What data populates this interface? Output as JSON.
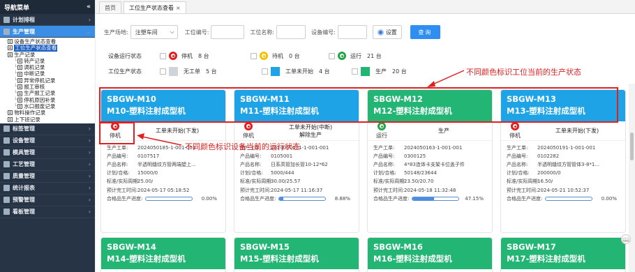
{
  "sidebar": {
    "title": "导航菜单",
    "collapse_icon": "«",
    "sections_top": [
      {
        "label": "计划排程",
        "icon": "calendar-icon"
      },
      {
        "label": "生产管理",
        "icon": "gear-icon",
        "active": true
      }
    ],
    "tree": [
      {
        "label": "设备生产状态查看",
        "level": 1
      },
      {
        "label": "工位生产状态查看",
        "level": 1,
        "selected": true
      },
      {
        "label": "生产记录",
        "level": 1,
        "folder": true
      },
      {
        "label": "转产记录",
        "level": 2
      },
      {
        "label": "调机记录",
        "level": 2
      },
      {
        "label": "中断记录",
        "level": 2
      },
      {
        "label": "异常停机记录",
        "level": 2
      },
      {
        "label": "报工审核",
        "level": 2
      },
      {
        "label": "生产报工记录",
        "level": 2
      },
      {
        "label": "停机原因补录",
        "level": 2
      },
      {
        "label": "水口报废记录",
        "level": 2
      },
      {
        "label": "物料操作记录",
        "level": 1
      },
      {
        "label": "上下班记录",
        "level": 1
      }
    ],
    "sections_bottom": [
      {
        "label": "标签管理",
        "icon": "tag-icon"
      },
      {
        "label": "设备管理",
        "icon": "device-icon"
      },
      {
        "label": "模具管理",
        "icon": "mold-icon"
      },
      {
        "label": "工艺管理",
        "icon": "process-icon"
      },
      {
        "label": "质量管理",
        "icon": "quality-icon"
      },
      {
        "label": "统计报表",
        "icon": "chart-icon"
      },
      {
        "label": "预警管理",
        "icon": "alert-icon"
      },
      {
        "label": "看板管理",
        "icon": "board-icon"
      }
    ]
  },
  "tabs": [
    {
      "label": "首页"
    },
    {
      "label": "工位生产状态查看",
      "close": "×",
      "active": true
    }
  ],
  "filter": {
    "site_label": "生产场地:",
    "site_value": "注塑车间",
    "station_no_label": "工位编号:",
    "station_name_label": "工位名称:",
    "device_no_label": "设备编号:",
    "settings_label": "设置",
    "query_label": "查询"
  },
  "legend": {
    "run_label": "设备运行状态",
    "prod_label": "工位生产状态",
    "run_items": [
      {
        "label": "停机",
        "count": "8 台",
        "color": "#e02020"
      },
      {
        "label": "待机",
        "count": "0 台",
        "color": "#f2c200"
      },
      {
        "label": "运行",
        "count": "21 台",
        "color": "#21a648"
      }
    ],
    "prod_items": [
      {
        "label": "无工单",
        "count": "5 台",
        "color": "#cfd4da"
      },
      {
        "label": "工单未开始",
        "count": "4 台",
        "color": "#1ea3e6"
      },
      {
        "label": "生产",
        "count": "20 台",
        "color": "#22b573"
      }
    ]
  },
  "annotations": {
    "station_status_note": "不同颜色标识工位当前的生产状态",
    "device_status_note": "不同颜色标识设备当前的运行状态"
  },
  "field_labels": {
    "order": "生产工单:",
    "product_no": "产品编号:",
    "product_name": "产品名称:",
    "plan": "计划/合格:",
    "cycle": "标准/实际周期:",
    "finish": "预计完工时间:",
    "progress": "合格品生产进度:"
  },
  "cards": [
    {
      "code": "SBGW-M10",
      "name": "M10-塑料注射成型机",
      "head_color": "#1ea3e6",
      "run_label": "停机",
      "run_color": "#e02020",
      "work_status": "工单未开始(下发)",
      "work_sub": "",
      "order": "2024050185-1-001-001",
      "product_no": "0107517",
      "product_name": "半透明缝纹方管两端塑上...",
      "plan": "15000/0",
      "cycle": "25.00/",
      "finish": "2024-05-17 05:18:52",
      "progress": "0.00%",
      "progress_value": 0
    },
    {
      "code": "SBGW-M11",
      "name": "M11-塑料注射成型机",
      "head_color": "#1ea3e6",
      "run_label": "停机",
      "run_color": "#e02020",
      "work_status": "工单未开始(中断)",
      "work_sub": "解除生产",
      "order": "2024050071-1-001-001",
      "product_no": "0105001",
      "product_name": "日系高管加长管10-12*62",
      "plan": "5000/444",
      "cycle": "30.00/25.57",
      "finish": "2024-05-17 11:16:37",
      "progress": "8.88%",
      "progress_value": 8.88
    },
    {
      "code": "SBGW-M12",
      "name": "M12-塑料注射成型机",
      "head_color": "#22b573",
      "run_label": "运行",
      "run_color": "#21a648",
      "work_status": "生产",
      "work_sub": "",
      "order": "2024050163-1-001-001",
      "product_no": "0300125",
      "product_name": "4*83连体卡支架卡位盖子件",
      "plan": "50148/23644",
      "cycle": "23.50/20.70",
      "finish": "2024-05-18 11:32:48",
      "progress": "47.15%",
      "progress_value": 47.15
    },
    {
      "code": "SBGW-M13",
      "name": "M13-塑料注射成型机",
      "head_color": "#1ea3e6",
      "run_label": "停机",
      "run_color": "#e02020",
      "work_status": "工单未开始(下发)",
      "work_sub": "",
      "order": "2024050191-1-001-001",
      "product_no": "0102282",
      "product_name": "半透明缝纹方管管体3-8*1...",
      "plan": "200000/0",
      "cycle": "16.50/",
      "finish": "2024-05-21 10:52:37",
      "progress": "0.00%",
      "progress_value": 0
    },
    {
      "code": "SBGW-M14",
      "name": "M14-塑料注射成型机",
      "head_color": "#22b573"
    },
    {
      "code": "SBGW-M15",
      "name": "M15-塑料注射成型机",
      "head_color": "#22b573"
    },
    {
      "code": "SBGW-M16",
      "name": "M16-塑料注射成型机",
      "head_color": "#22b573"
    },
    {
      "code": "SBGW-M17",
      "name": "M17-塑料注射成型机",
      "head_color": "#22b573"
    }
  ]
}
